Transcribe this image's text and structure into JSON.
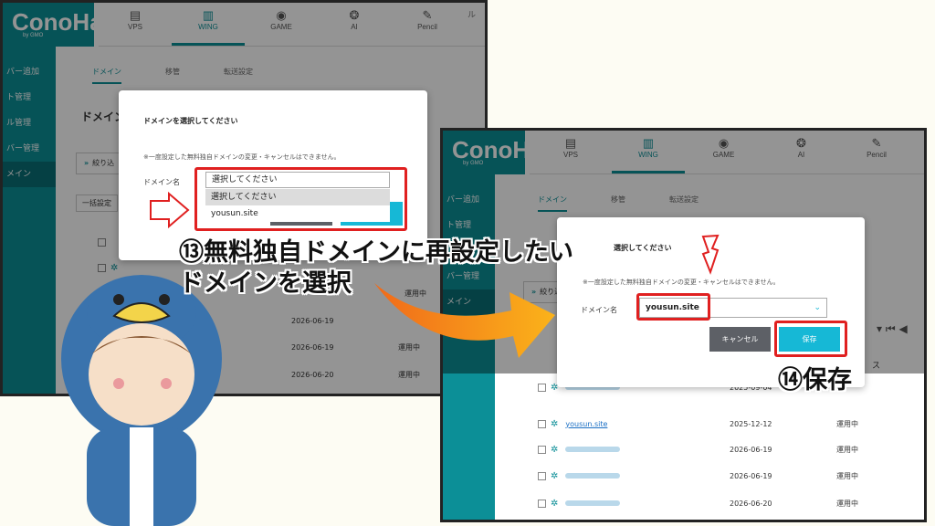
{
  "brand": {
    "logo": "ConoHa",
    "sub": "by GMO"
  },
  "nav": [
    {
      "label": "VPS",
      "icon": "server-icon"
    },
    {
      "label": "WING",
      "icon": "wing-icon"
    },
    {
      "label": "GAME",
      "icon": "gamepad-icon"
    },
    {
      "label": "AI",
      "icon": "ai-icon"
    },
    {
      "label": "Pencil",
      "icon": "pencil-icon"
    }
  ],
  "help_fragment": "ル",
  "sidebar1": [
    "バー追加",
    "ト管理",
    "ル管理",
    "バー管理",
    "メイン",
    "",
    "ー",
    ""
  ],
  "sidebar2": [
    "バー追加",
    "ト管理",
    "",
    "バー管理",
    "メイン",
    ""
  ],
  "subtabs": [
    "ドメイン",
    "移管",
    "転送設定"
  ],
  "page_heading": "ドメイン",
  "filter": {
    "prefix": "»",
    "label": "絞り込"
  },
  "bulk_label": "一括設定",
  "modal": {
    "title": "ドメインを選択してください",
    "title2_fragment": "選択してください",
    "note": "※一度設定した無料独自ドメインの変更・キャンセルはできません。",
    "field_label": "ドメイン名",
    "placeholder": "選択してください",
    "options": [
      "選択してください",
      "yousun.site"
    ],
    "selected": "yousun.site",
    "cancel": "キャンセル",
    "save": "保存"
  },
  "rows1": [
    {
      "date": "2026-06-19",
      "status": ""
    },
    {
      "date": "2026-06-19",
      "status": "運用中"
    },
    {
      "date": "2026-06-20",
      "status": "運用中"
    }
  ],
  "status_fragment": "運用中",
  "rows2": [
    {
      "domain": "",
      "date": "2025-09-04",
      "status": ""
    },
    {
      "domain": "yousun.site",
      "date": "2025-12-12",
      "status": "運用中"
    },
    {
      "domain": "",
      "date": "2026-06-19",
      "status": "運用中"
    },
    {
      "domain": "",
      "date": "2026-06-19",
      "status": "運用中"
    },
    {
      "domain": "",
      "date": "2026-06-20",
      "status": "運用中"
    }
  ],
  "header_fragment": "ス",
  "annotation": {
    "step13_line1": "⑬無料独自ドメインに再設定したい",
    "step13_line2": "ドメインを選択",
    "step14": "⑭保存"
  },
  "colors": {
    "brand": "#0c8f97",
    "accent": "#16b8d6",
    "highlight": "#e02020",
    "arrow": "#f28c1a"
  }
}
